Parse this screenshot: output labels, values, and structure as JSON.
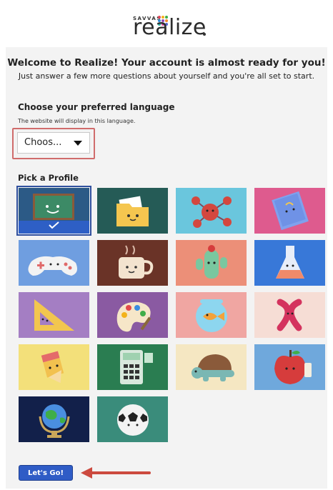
{
  "brand": {
    "name": "realize",
    "company": "SAVVAS",
    "dot_colors": [
      "#e2475b",
      "#f3b21b",
      "#3fae49",
      "#2f8bd6",
      "#8e4ab5",
      "#f08a2c",
      "#2fb6a8",
      "#e24aa1",
      "#5465c9"
    ]
  },
  "welcome": {
    "title": "Welcome to Realize! Your account is almost ready for you!",
    "subtitle": "Just answer a few more questions about yourself and you're all set to start."
  },
  "language": {
    "heading": "Choose your preferred language",
    "help": "The website will display in this language.",
    "selected": "Choos..."
  },
  "profile": {
    "heading": "Pick a Profile",
    "options": [
      {
        "icon": "chalkboard-icon",
        "bg": "#2c5a86",
        "selected": true
      },
      {
        "icon": "folder-icon",
        "bg": "#255b56"
      },
      {
        "icon": "molecule-icon",
        "bg": "#6ac6dd"
      },
      {
        "icon": "notebook-icon",
        "bg": "#de5b8e"
      },
      {
        "icon": "game-controller-icon",
        "bg": "#6f9ee0"
      },
      {
        "icon": "coffee-cup-icon",
        "bg": "#6a3327"
      },
      {
        "icon": "cactus-icon",
        "bg": "#ec8f78"
      },
      {
        "icon": "flask-icon",
        "bg": "#3878d8"
      },
      {
        "icon": "triangle-ruler-icon",
        "bg": "#a47ec3"
      },
      {
        "icon": "paint-palette-icon",
        "bg": "#8a5aa2"
      },
      {
        "icon": "fishbowl-icon",
        "bg": "#f0a6a2"
      },
      {
        "icon": "dna-icon",
        "bg": "#f6ddd5"
      },
      {
        "icon": "pencil-icon",
        "bg": "#f3e07a"
      },
      {
        "icon": "calculator-icon",
        "bg": "#2a7d51"
      },
      {
        "icon": "turtle-icon",
        "bg": "#f5e7c2"
      },
      {
        "icon": "apple-icon",
        "bg": "#6fa8dc"
      },
      {
        "icon": "globe-icon",
        "bg": "#12204a"
      },
      {
        "icon": "soccer-ball-icon",
        "bg": "#3a8c7b"
      }
    ]
  },
  "action": {
    "button_label": "Let's Go!",
    "arrow_color": "#cc4a3f"
  }
}
